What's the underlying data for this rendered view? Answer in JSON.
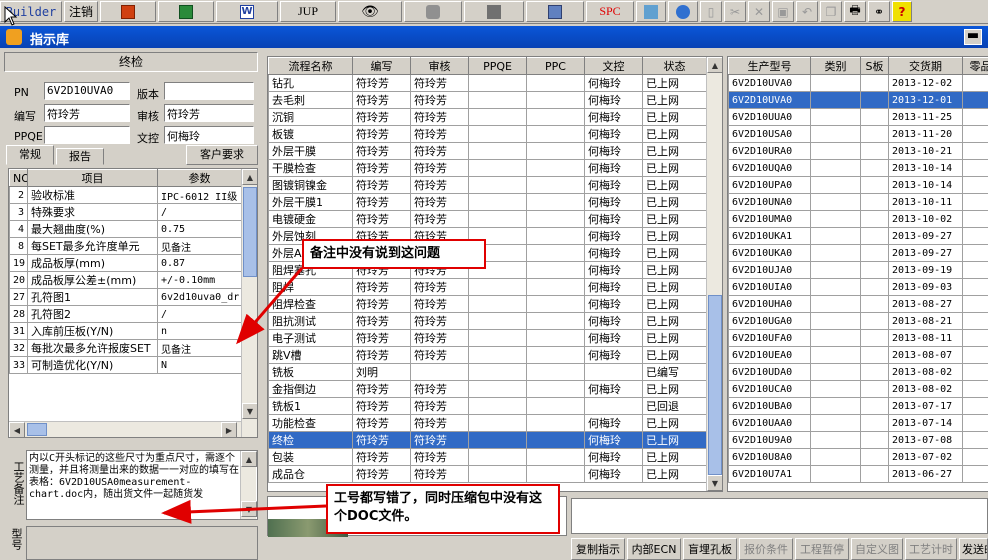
{
  "toolbar": {
    "builder": "Builder",
    "logout": "注销",
    "jup": "JUP",
    "spc": "SPC"
  },
  "window": {
    "title": "指示库"
  },
  "left": {
    "section_title": "终检",
    "pn_label": "PN",
    "pn_value": "6V2D10UVA0",
    "version_label": "版本",
    "version_value": "",
    "writer_label": "编写",
    "writer_value": "符玲芳",
    "review_label": "审核",
    "review_value": "符玲芳",
    "ppqe_label": "PPQE",
    "ppqe_value": "",
    "doc_label": "文控",
    "doc_value": "何梅玲",
    "tabs": [
      "常规",
      "报告",
      "客户要求"
    ],
    "params_headers": [
      "NO",
      "项目",
      "参数"
    ],
    "params": [
      [
        "2",
        "验收标准",
        "IPC-6012 II级"
      ],
      [
        "3",
        "特殊要求",
        "/"
      ],
      [
        "4",
        "最大翘曲度(%)",
        "0.75"
      ],
      [
        "8",
        "每SET最多允许度单元",
        "见备注"
      ],
      [
        "19",
        "成品板厚(mm)",
        "0.87"
      ],
      [
        "20",
        "成品板厚公差±(mm)",
        "+/-0.10mm"
      ],
      [
        "27",
        "孔符图1",
        "6v2d10uva0_dr"
      ],
      [
        "28",
        "孔符图2",
        "/"
      ],
      [
        "31",
        "入库前压板(Y/N)",
        "n"
      ],
      [
        "32",
        "每批次最多允许报废SET",
        "见备注"
      ],
      [
        "33",
        "可制造优化(Y/N)",
        "N"
      ]
    ],
    "remark_label": "工艺备注",
    "remark_text": "内以C开头标记的这些尺寸为重点尺寸，需逐个测量，并且将测量出来的数据一一对应的填写在表格：6V2D10USA0measurement-chart.doc内，随出货文件一起随货发",
    "model_label": "型号"
  },
  "middle": {
    "headers": [
      "流程名称",
      "编写",
      "审核",
      "PPQE",
      "PPC",
      "文控",
      "状态"
    ],
    "rows": [
      [
        "钻孔",
        "符玲芳",
        "符玲芳",
        "",
        "",
        "何梅玲",
        "已上网"
      ],
      [
        "去毛刺",
        "符玲芳",
        "符玲芳",
        "",
        "",
        "何梅玲",
        "已上网"
      ],
      [
        "沉铜",
        "符玲芳",
        "符玲芳",
        "",
        "",
        "何梅玲",
        "已上网"
      ],
      [
        "板镀",
        "符玲芳",
        "符玲芳",
        "",
        "",
        "何梅玲",
        "已上网"
      ],
      [
        "外层干膜",
        "符玲芳",
        "符玲芳",
        "",
        "",
        "何梅玲",
        "已上网"
      ],
      [
        "干膜检查",
        "符玲芳",
        "符玲芳",
        "",
        "",
        "何梅玲",
        "已上网"
      ],
      [
        "图镀铜镍金",
        "符玲芳",
        "符玲芳",
        "",
        "",
        "何梅玲",
        "已上网"
      ],
      [
        "外层干膜1",
        "符玲芳",
        "符玲芳",
        "",
        "",
        "何梅玲",
        "已上网"
      ],
      [
        "电镀硬金",
        "符玲芳",
        "符玲芳",
        "",
        "",
        "何梅玲",
        "已上网"
      ],
      [
        "外层蚀刻",
        "符玲芳",
        "符玲芳",
        "",
        "",
        "何梅玲",
        "已上网"
      ],
      [
        "外层AOI",
        "符玲芳",
        "符玲芳",
        "",
        "",
        "何梅玲",
        "已上网"
      ],
      [
        "阻焊塞孔",
        "符玲芳",
        "符玲芳",
        "",
        "",
        "何梅玲",
        "已上网"
      ],
      [
        "阻焊",
        "符玲芳",
        "符玲芳",
        "",
        "",
        "何梅玲",
        "已上网"
      ],
      [
        "阻焊检查",
        "符玲芳",
        "符玲芳",
        "",
        "",
        "何梅玲",
        "已上网"
      ],
      [
        "阻抗测试",
        "符玲芳",
        "符玲芳",
        "",
        "",
        "何梅玲",
        "已上网"
      ],
      [
        "电子测试",
        "符玲芳",
        "符玲芳",
        "",
        "",
        "何梅玲",
        "已上网"
      ],
      [
        "跳V槽",
        "符玲芳",
        "符玲芳",
        "",
        "",
        "何梅玲",
        "已上网"
      ],
      [
        "铣板",
        "刘明",
        "",
        "",
        "",
        "",
        "已编写"
      ],
      [
        "金指倒边",
        "符玲芳",
        "符玲芳",
        "",
        "",
        "何梅玲",
        "已上网"
      ],
      [
        "铣板1",
        "符玲芳",
        "符玲芳",
        "",
        "",
        "",
        "已回退"
      ],
      [
        "功能检查",
        "符玲芳",
        "符玲芳",
        "",
        "",
        "何梅玲",
        "已上网"
      ],
      [
        "终检",
        "符玲芳",
        "符玲芳",
        "",
        "",
        "何梅玲",
        "已上网"
      ],
      [
        "包装",
        "符玲芳",
        "符玲芳",
        "",
        "",
        "何梅玲",
        "已上网"
      ],
      [
        "成品仓",
        "符玲芳",
        "符玲芳",
        "",
        "",
        "何梅玲",
        "已上网"
      ]
    ]
  },
  "right": {
    "headers": [
      "生产型号",
      "类别",
      "S板",
      "交货期",
      "零品"
    ],
    "rows": [
      [
        "6V2D10UVA0",
        "2013-12-02"
      ],
      [
        "6V2D10UVA0",
        "2013-12-01"
      ],
      [
        "6V2D10UUA0",
        "2013-11-25"
      ],
      [
        "6V2D10USA0",
        "2013-11-20"
      ],
      [
        "6V2D10URA0",
        "2013-10-21"
      ],
      [
        "6V2D10UQA0",
        "2013-10-14"
      ],
      [
        "6V2D10UPA0",
        "2013-10-14"
      ],
      [
        "6V2D10UNA0",
        "2013-10-11"
      ],
      [
        "6V2D10UMA0",
        "2013-10-02"
      ],
      [
        "6V2D10UKA1",
        "2013-09-27"
      ],
      [
        "6V2D10UKA0",
        "2013-09-27"
      ],
      [
        "6V2D10UJA0",
        "2013-09-19"
      ],
      [
        "6V2D10UIA0",
        "2013-09-03"
      ],
      [
        "6V2D10UHA0",
        "2013-08-27"
      ],
      [
        "6V2D10UGA0",
        "2013-08-21"
      ],
      [
        "6V2D10UFA0",
        "2013-08-11"
      ],
      [
        "6V2D10UEA0",
        "2013-08-07"
      ],
      [
        "6V2D10UDA0",
        "2013-08-02"
      ],
      [
        "6V2D10UCA0",
        "2013-08-02"
      ],
      [
        "6V2D10UBA0",
        "2013-07-17"
      ],
      [
        "6V2D10UAA0",
        "2013-07-14"
      ],
      [
        "6V2D10U9A0",
        "2013-07-08"
      ],
      [
        "6V2D10U8A0",
        "2013-07-02"
      ],
      [
        "6V2D10U7A1",
        "2013-06-27"
      ]
    ]
  },
  "buttons": [
    "复制指示",
    "内部ECN",
    "盲埋孔板",
    "报价条件",
    "工程暂停",
    "自定义图",
    "工艺计时",
    "发送邮"
  ],
  "callouts": {
    "c1": "备注中没有说到这问题",
    "c2": "工号都写错了，同时压缩包中没有这个DOC文件。"
  },
  "colors": {
    "title_bar": "#0842b4",
    "selection": "#316ac5",
    "annotation": "#e00000"
  }
}
